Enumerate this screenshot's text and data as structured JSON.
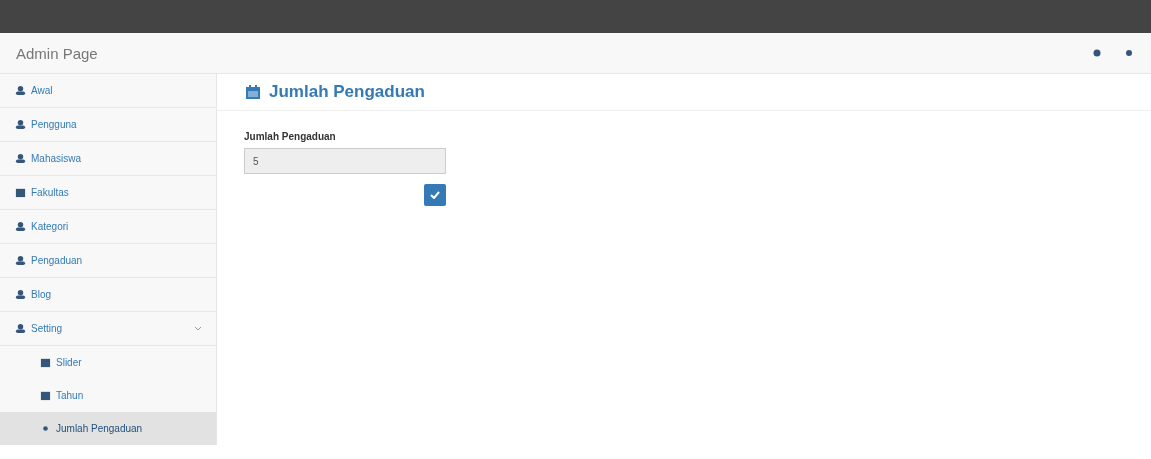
{
  "navbar": {
    "brand": "Admin Page"
  },
  "sidebar": {
    "items": [
      {
        "label": "Awal",
        "selected": false
      },
      {
        "label": "Pengguna",
        "selected": false
      },
      {
        "label": "Mahasiswa",
        "selected": false
      },
      {
        "label": "Fakultas",
        "selected": false
      },
      {
        "label": "Kategori",
        "selected": false
      },
      {
        "label": "Pengaduan",
        "selected": false
      },
      {
        "label": "Blog",
        "selected": false
      },
      {
        "label": "Setting",
        "selected": false,
        "expanded": true,
        "children": [
          {
            "label": "Slider",
            "selected": false
          },
          {
            "label": "Tahun",
            "selected": false
          },
          {
            "label": "Jumlah Pengaduan",
            "selected": true
          }
        ]
      }
    ]
  },
  "page": {
    "title": "Jumlah Pengaduan",
    "form": {
      "label": "Jumlah Pengaduan",
      "value": "5"
    }
  }
}
